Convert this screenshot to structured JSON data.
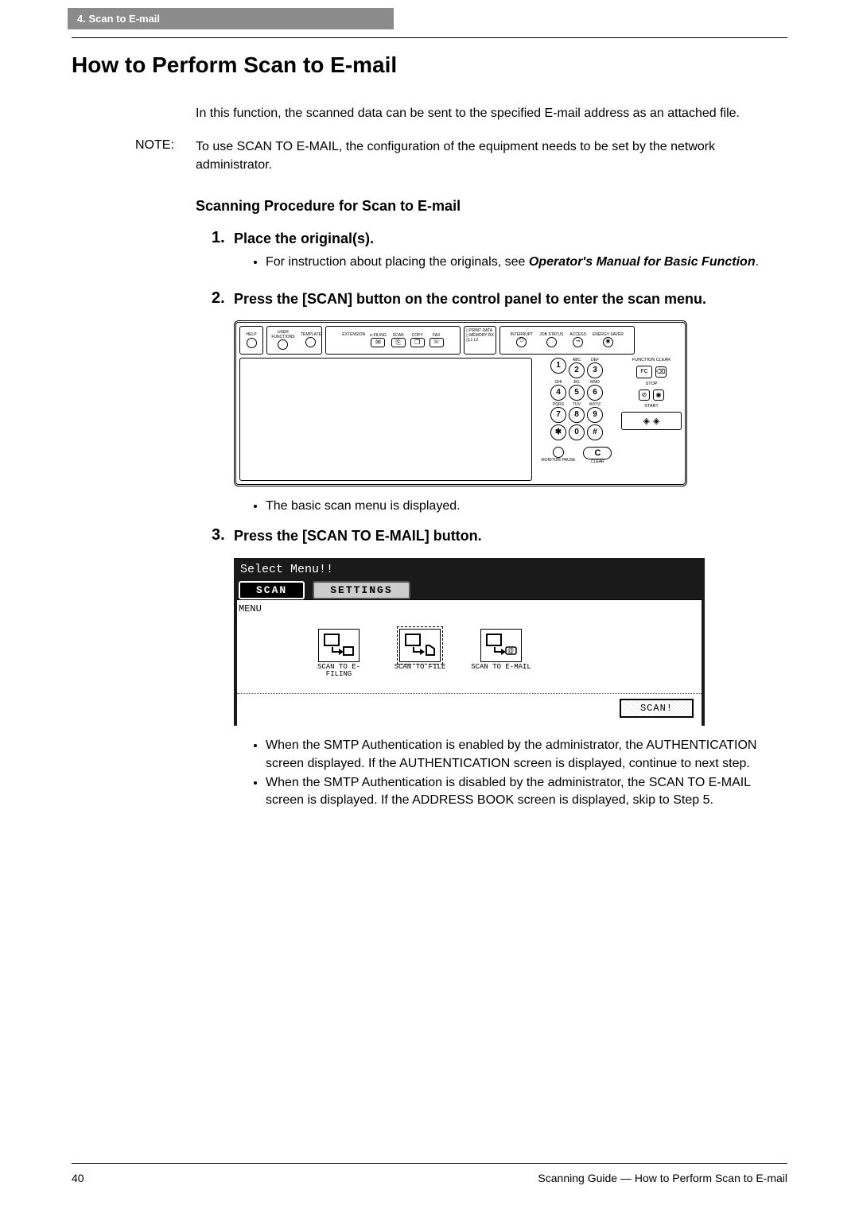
{
  "header_tab": "4. Scan to E-mail",
  "title": "How to Perform Scan to E-mail",
  "intro": "In this function, the scanned data can be sent to the specified E-mail address as an attached file.",
  "note_label": "NOTE:",
  "note_body": "To use SCAN TO E-MAIL, the configuration of the equipment needs to be set by the network administrator.",
  "subheading": "Scanning Procedure for Scan to E-mail",
  "steps": {
    "1": {
      "title": "Place the original(s).",
      "bullet": "For instruction about placing the originals, see ",
      "ref": "Operator's Manual for Basic Function",
      "period": "."
    },
    "2": {
      "title": "Press the [SCAN] button on the control panel to enter the scan menu.",
      "after_bullet": "The basic scan menu is displayed."
    },
    "3": {
      "title": "Press the [SCAN TO E-MAIL] button.",
      "bullets": [
        "When the SMTP Authentication is enabled by the administrator, the AUTHENTICATION screen displayed.  If the AUTHENTICATION screen is displayed, continue to next step.",
        "When the SMTP Authentication is disabled by the administrator, the SCAN TO E-MAIL screen is displayed.  If the ADDRESS BOOK screen is displayed, skip to Step 5."
      ]
    }
  },
  "control_panel": {
    "buttons_top": [
      "HELP",
      "USER FUNCTIONS",
      "TEMPLATE",
      "EXTENSION",
      "e-FILING",
      "SCAN",
      "COPY",
      "FAX"
    ],
    "status": [
      "PRINT DATA",
      "MEMORY RX",
      "L1 L2"
    ],
    "right_top": [
      "INTERRUPT",
      "JOB STATUS",
      "ACCESS",
      "ENERGY SAVER"
    ],
    "function_clear": "FUNCTION CLEAR",
    "fc": "FC",
    "stop": "STOP",
    "start": "START",
    "keypad_sub": [
      "",
      "ABC",
      "DEF",
      "GHI",
      "JKL",
      "MNO",
      "PQRS",
      "TUV",
      "WXYZ"
    ],
    "keys": [
      "1",
      "2",
      "3",
      "4",
      "5",
      "6",
      "7",
      "8",
      "9",
      "✱",
      "0",
      "#"
    ],
    "monitor": "MONITOR/ PAUSE",
    "clear": "CLEAR",
    "c_key": "C"
  },
  "scan_menu": {
    "header": "Select Menu!!",
    "tab_scan": "SCAN",
    "tab_settings": "SETTINGS",
    "menu_label": "MENU",
    "items": [
      {
        "label": "SCAN TO E-FILING"
      },
      {
        "label": "SCAN TO FILE"
      },
      {
        "label": "SCAN TO E-MAIL"
      }
    ],
    "scan_button": "SCAN!"
  },
  "footer": {
    "page": "40",
    "right": "Scanning Guide — How to Perform Scan to E-mail"
  }
}
